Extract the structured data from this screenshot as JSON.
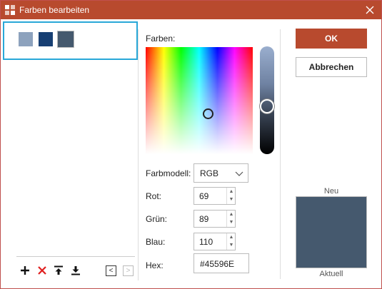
{
  "window": {
    "title": "Farben bearbeiten",
    "close_icon": "close-icon"
  },
  "palette": {
    "swatches": [
      {
        "color": "#8da2bd"
      },
      {
        "color": "#173f73"
      },
      {
        "color": "#45596e",
        "selected": true
      }
    ]
  },
  "toolbar": {
    "add_icon": "plus-icon",
    "delete_icon": "x-icon",
    "move_top_icon": "arrow-up-bar-icon",
    "move_bottom_icon": "arrow-down-bar-icon",
    "prev_glyph": "<",
    "next_glyph": ">"
  },
  "picker": {
    "label": "Farben:"
  },
  "model": {
    "label": "Farbmodell:",
    "value": "RGB"
  },
  "channels": {
    "red": {
      "label": "Rot:",
      "value": "69"
    },
    "green": {
      "label": "Grün:",
      "value": "89"
    },
    "blue": {
      "label": "Blau:",
      "value": "110"
    }
  },
  "hex": {
    "label": "Hex:",
    "value": "#45596E"
  },
  "buttons": {
    "ok": "OK",
    "cancel": "Abbrechen"
  },
  "preview": {
    "new_label": "Neu",
    "current_label": "Aktuell",
    "color": "#45596e"
  },
  "colors": {
    "accent": "#b84a2e",
    "focus_border": "#29a8d8"
  }
}
